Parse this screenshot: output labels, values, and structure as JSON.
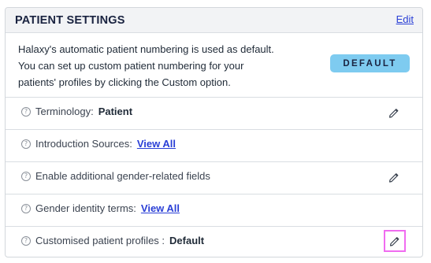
{
  "header": {
    "title": "PATIENT SETTINGS",
    "edit_label": "Edit"
  },
  "intro": {
    "text": "Halaxy's automatic patient numbering is used as default. You can set up custom patient numbering for your patients' profiles by clicking the Custom option.",
    "button_label": "DEFAULT",
    "button_color": "#7ecbf0"
  },
  "rows": [
    {
      "label": "Terminology:",
      "value": "Patient",
      "editable": true
    },
    {
      "label": "Introduction Sources:",
      "link": "View All",
      "editable": false
    },
    {
      "label": "Enable additional gender-related fields",
      "editable": true
    },
    {
      "label": "Gender identity terms:",
      "link": "View All",
      "editable": false
    },
    {
      "label": "Customised patient profiles :",
      "value": "Default",
      "editable": true,
      "highlighted": true
    }
  ],
  "colors": {
    "link": "#2a3fd6",
    "highlight": "#f06cf0"
  }
}
